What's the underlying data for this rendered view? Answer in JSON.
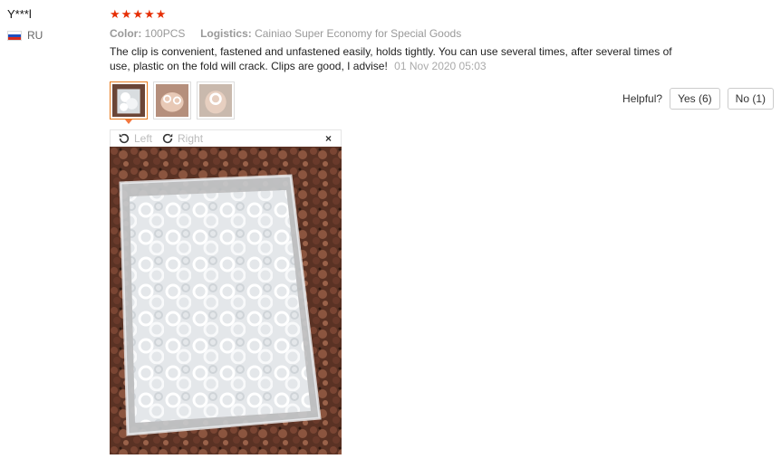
{
  "user": {
    "name": "Y***l",
    "country": "RU"
  },
  "review": {
    "rating": 5,
    "color_label": "Color:",
    "color_value": "100PCS",
    "logistics_label": "Logistics:",
    "logistics_value": "Cainiao Super Economy for Special Goods",
    "text": "The clip is convenient, fastened and unfastened easily, holds tightly. You can use several times, after several times of use, plastic on the fold will crack. Clips are good, I advise!",
    "date": "01 Nov 2020 05:03"
  },
  "helpful": {
    "label": "Helpful?",
    "yes": "Yes (6)",
    "no": "No (1)"
  },
  "viewer": {
    "left": "Left",
    "right": "Right",
    "close": "×"
  },
  "icons": {
    "star": "star-icon",
    "flag": "russia-flag-icon",
    "rotate_left": "rotate-left-icon",
    "rotate_right": "rotate-right-icon",
    "close": "close-icon"
  },
  "colors": {
    "star": "#e62e04",
    "active_border": "#e87a1c"
  }
}
